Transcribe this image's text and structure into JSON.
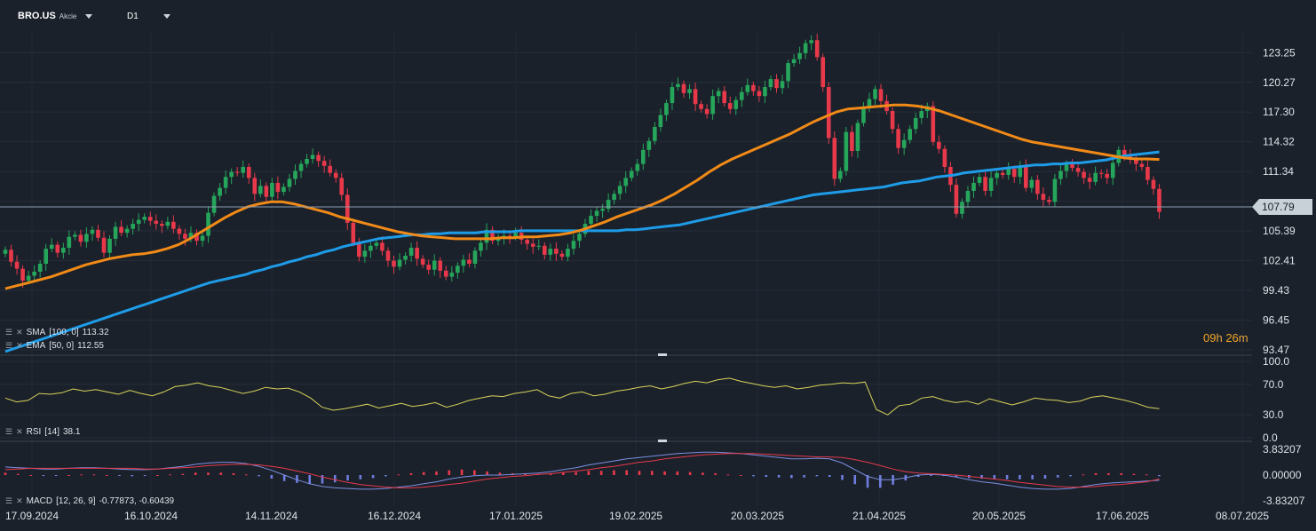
{
  "header": {
    "symbol": "BRO.US",
    "symbol_type": "Akcie",
    "timeframe": "D1"
  },
  "countdown": {
    "hours": "09",
    "h_unit": "h",
    "minutes": "26",
    "m_unit": "m"
  },
  "colors": {
    "background": "#1a212b",
    "up_candle": "#26a65b",
    "down_candle": "#e8394a",
    "sma": "#1e9ce8",
    "ema": "#f18a17",
    "rsi": "#d8d45a",
    "macd_line": "#7d8fe0",
    "signal_line": "#e8394a",
    "hist_pos": "#e8394a",
    "hist_neg": "#6f7de0",
    "price_line": "#8fa0b0",
    "grid": "#252d38"
  },
  "indicators": {
    "sma": {
      "label": "SMA",
      "params": "[100, 0]",
      "value": "113.32"
    },
    "ema": {
      "label": "EMA",
      "params": "[50, 0]",
      "value": "112.55"
    },
    "rsi": {
      "label": "RSI",
      "params": "[14]",
      "value": "38.1"
    },
    "macd": {
      "label": "MACD",
      "params": "[12, 26, 9]",
      "values": "-0.77873, -0.60439"
    }
  },
  "chart_data": [
    {
      "type": "candlestick",
      "title": "BRO.US D1",
      "current_price": 107.79,
      "current_price_label": "107.79",
      "ylim": [
        93.47,
        125.5
      ],
      "y_ticks": [
        "123.25",
        "120.27",
        "117.30",
        "114.32",
        "111.34",
        "108.36",
        "105.39",
        "102.41",
        "99.43",
        "96.45",
        "93.47"
      ],
      "x_ticks": [
        "17.09.2024",
        "16.10.2024",
        "14.11.2024",
        "16.12.2024",
        "17.01.2025",
        "19.02.2025",
        "20.03.2025",
        "21.04.2025",
        "20.05.2025",
        "17.06.2025",
        "08.07.2025"
      ],
      "close": [
        103.5,
        102.3,
        101.6,
        100.4,
        100.9,
        101.3,
        102.1,
        103.6,
        104.0,
        103.2,
        103.7,
        104.8,
        105.0,
        104.3,
        105.1,
        105.5,
        104.7,
        103.2,
        104.6,
        105.8,
        105.2,
        105.6,
        106.1,
        106.5,
        106.8,
        106.4,
        106.1,
        105.9,
        106.3,
        105.6,
        105.1,
        104.6,
        105.2,
        104.4,
        104.9,
        107.2,
        108.9,
        109.7,
        110.8,
        111.3,
        111.2,
        111.8,
        110.7,
        109.1,
        109.9,
        108.8,
        110.2,
        109.3,
        109.8,
        110.6,
        111.4,
        112.1,
        112.6,
        113.0,
        112.4,
        111.9,
        111.2,
        110.7,
        109.0,
        106.2,
        104.2,
        102.8,
        103.4,
        103.9,
        104.2,
        103.4,
        102.4,
        101.8,
        102.5,
        102.9,
        103.7,
        102.6,
        102.0,
        101.5,
        102.4,
        101.4,
        100.8,
        101.2,
        101.9,
        102.5,
        102.1,
        103.4,
        104.2,
        105.5,
        104.4,
        104.6,
        104.9,
        104.8,
        105.2,
        104.5,
        104.1,
        103.8,
        103.9,
        103.0,
        103.6,
        103.1,
        102.8,
        103.6,
        104.4,
        105.1,
        106.1,
        106.9,
        107.4,
        107.6,
        108.5,
        109.1,
        109.9,
        110.7,
        111.4,
        112.1,
        113.5,
        114.4,
        115.8,
        117.0,
        118.2,
        119.8,
        120.1,
        119.2,
        119.6,
        118.1,
        117.6,
        117.1,
        118.9,
        119.4,
        118.2,
        117.6,
        118.5,
        119.3,
        120.0,
        119.4,
        118.9,
        119.8,
        120.6,
        119.7,
        120.4,
        122.2,
        122.6,
        123.2,
        124.2,
        124.5,
        122.8,
        119.8,
        114.7,
        110.6,
        111.4,
        115.3,
        113.4,
        116.2,
        117.8,
        118.6,
        119.6,
        118.4,
        117.4,
        115.6,
        113.7,
        114.5,
        115.6,
        116.7,
        117.4,
        117.9,
        114.3,
        113.6,
        111.8,
        110.0,
        107.1,
        108.3,
        109.4,
        110.2,
        110.8,
        109.4,
        110.7,
        111.2,
        111.0,
        111.6,
        110.8,
        111.9,
        109.7,
        110.5,
        109.1,
        108.5,
        108.3,
        110.6,
        111.4,
        112.1,
        111.7,
        111.3,
        110.7,
        110.3,
        111.2,
        111.1,
        110.7,
        112.2,
        113.5,
        112.9,
        112.7,
        112.1,
        111.8,
        110.5,
        109.6,
        107.3
      ],
      "series": [
        {
          "name": "SMA",
          "params": "[100, 0]",
          "last": 113.32,
          "values": [
            93.3,
            93.6,
            93.9,
            94.2,
            94.5,
            94.8,
            95.1,
            95.4,
            95.7,
            96.0,
            96.3,
            96.6,
            96.9,
            97.2,
            97.5,
            97.8,
            98.1,
            98.4,
            98.7,
            99.0,
            99.3,
            99.6,
            99.9,
            100.2,
            100.4,
            100.6,
            100.8,
            101.0,
            101.3,
            101.5,
            101.8,
            102.0,
            102.3,
            102.5,
            102.8,
            103.0,
            103.3,
            103.5,
            103.8,
            104.0,
            104.2,
            104.4,
            104.6,
            104.7,
            104.8,
            104.9,
            105.0,
            105.0,
            105.1,
            105.1,
            105.2,
            105.2,
            105.2,
            105.2,
            105.3,
            105.3,
            105.3,
            105.3,
            105.4,
            105.4,
            105.4,
            105.4,
            105.4,
            105.4,
            105.4,
            105.4,
            105.4,
            105.4,
            105.4,
            105.4,
            105.5,
            105.5,
            105.6,
            105.7,
            105.8,
            105.9,
            106.0,
            106.2,
            106.4,
            106.6,
            106.8,
            107.0,
            107.2,
            107.4,
            107.6,
            107.8,
            108.0,
            108.2,
            108.4,
            108.6,
            108.8,
            109.0,
            109.1,
            109.2,
            109.3,
            109.4,
            109.5,
            109.6,
            109.7,
            109.8,
            110.0,
            110.2,
            110.3,
            110.4,
            110.6,
            110.8,
            110.9,
            111.0,
            111.2,
            111.3,
            111.4,
            111.5,
            111.6,
            111.7,
            111.8,
            111.9,
            112.0,
            112.0,
            112.1,
            112.1,
            112.2,
            112.2,
            112.3,
            112.4,
            112.5,
            112.7,
            112.9,
            113.0,
            113.1,
            113.2,
            113.3
          ]
        },
        {
          "name": "EMA",
          "params": "[50, 0]",
          "last": 112.55,
          "values": [
            99.6,
            99.9,
            100.2,
            100.5,
            100.8,
            101.2,
            101.6,
            102.0,
            102.3,
            102.6,
            102.8,
            103.0,
            103.1,
            103.3,
            103.6,
            104.0,
            104.6,
            105.3,
            106.0,
            106.7,
            107.3,
            107.8,
            108.1,
            108.3,
            108.3,
            108.1,
            107.8,
            107.5,
            107.2,
            106.8,
            106.5,
            106.2,
            105.9,
            105.6,
            105.3,
            105.1,
            104.9,
            104.8,
            104.7,
            104.6,
            104.6,
            104.6,
            104.6,
            104.7,
            104.7,
            104.8,
            104.8,
            104.9,
            105.0,
            105.2,
            105.5,
            105.9,
            106.3,
            106.8,
            107.2,
            107.6,
            108.0,
            108.5,
            109.1,
            109.8,
            110.5,
            111.3,
            112.0,
            112.6,
            113.1,
            113.6,
            114.1,
            114.6,
            115.1,
            115.7,
            116.3,
            116.8,
            117.3,
            117.6,
            117.7,
            117.8,
            117.9,
            118.0,
            118.0,
            117.9,
            117.7,
            117.4,
            117.0,
            116.6,
            116.2,
            115.8,
            115.4,
            115.0,
            114.6,
            114.3,
            114.1,
            113.9,
            113.7,
            113.5,
            113.3,
            113.1,
            112.9,
            112.7,
            112.6,
            112.6,
            112.55
          ]
        },
        {
          "name": "RSI",
          "params": "[14]",
          "last": 38.1,
          "values": [
            52,
            47,
            49,
            58,
            57,
            59,
            64,
            61,
            63,
            60,
            57,
            62,
            58,
            55,
            60,
            67,
            69,
            72,
            68,
            66,
            62,
            58,
            61,
            66,
            64,
            65,
            60,
            52,
            40,
            36,
            38,
            41,
            44,
            39,
            42,
            45,
            41,
            43,
            46,
            40,
            44,
            49,
            52,
            55,
            54,
            58,
            60,
            63,
            55,
            52,
            58,
            60,
            55,
            57,
            61,
            63,
            66,
            68,
            64,
            67,
            71,
            74,
            72,
            76,
            78,
            74,
            71,
            68,
            66,
            68,
            64,
            66,
            69,
            70,
            72,
            71,
            73,
            37,
            30,
            42,
            44,
            52,
            54,
            49,
            46,
            48,
            44,
            51,
            47,
            43,
            47,
            52,
            50,
            49,
            46,
            48,
            53,
            55,
            52,
            49,
            45,
            40,
            38
          ]
        },
        {
          "name": "MACD",
          "params": "[12, 26, 9]",
          "last": -0.77873,
          "values": [
            1.2,
            1.1,
            1.0,
            0.9,
            0.9,
            1.0,
            1.1,
            1.1,
            1.0,
            0.9,
            0.8,
            0.8,
            0.9,
            1.1,
            1.3,
            1.6,
            1.8,
            1.9,
            1.9,
            1.7,
            1.3,
            0.7,
            0.0,
            -0.7,
            -1.3,
            -1.7,
            -1.9,
            -2.0,
            -2.1,
            -2.1,
            -2.0,
            -1.8,
            -1.6,
            -1.3,
            -1.0,
            -0.6,
            -0.3,
            -0.1,
            0.0,
            0.0,
            0.1,
            0.2,
            0.3,
            0.5,
            0.8,
            1.1,
            1.5,
            1.8,
            2.1,
            2.4,
            2.6,
            2.8,
            3.0,
            3.2,
            3.3,
            3.4,
            3.4,
            3.3,
            3.2,
            3.0,
            2.8,
            2.6,
            2.4,
            2.4,
            2.5,
            2.4,
            1.8,
            0.8,
            -0.2,
            -0.7,
            -0.7,
            -0.4,
            0.0,
            0.1,
            0.0,
            -0.3,
            -0.7,
            -1.0,
            -1.2,
            -1.5,
            -1.8,
            -2.0,
            -2.1,
            -2.1,
            -2.0,
            -1.7,
            -1.4,
            -1.2,
            -1.1,
            -1.0,
            -0.9,
            -0.78
          ]
        },
        {
          "name": "Signal",
          "values": [
            0.8,
            0.9,
            1.0,
            1.0,
            1.0,
            1.0,
            1.0,
            1.0,
            1.0,
            1.0,
            1.0,
            0.9,
            0.9,
            1.0,
            1.1,
            1.2,
            1.4,
            1.5,
            1.6,
            1.6,
            1.5,
            1.3,
            1.0,
            0.6,
            0.2,
            -0.3,
            -0.7,
            -1.1,
            -1.4,
            -1.6,
            -1.8,
            -1.9,
            -1.9,
            -1.8,
            -1.6,
            -1.4,
            -1.2,
            -0.9,
            -0.6,
            -0.4,
            -0.2,
            -0.1,
            0.1,
            0.2,
            0.4,
            0.6,
            0.8,
            1.1,
            1.3,
            1.6,
            1.9,
            2.1,
            2.4,
            2.6,
            2.8,
            3.0,
            3.1,
            3.2,
            3.2,
            3.2,
            3.1,
            3.0,
            2.9,
            2.8,
            2.7,
            2.7,
            2.6,
            2.3,
            1.9,
            1.4,
            0.9,
            0.5,
            0.3,
            0.2,
            0.1,
            0.0,
            -0.2,
            -0.4,
            -0.6,
            -0.8,
            -1.1,
            -1.3,
            -1.5,
            -1.7,
            -1.8,
            -1.8,
            -1.7,
            -1.5,
            -1.4,
            -1.2,
            -1.0,
            -0.6
          ]
        }
      ],
      "panels": [
        {
          "name": "RSI",
          "ylim": [
            0,
            100
          ],
          "y_ticks": [
            "100.0",
            "70.0",
            "30.0",
            "0.0"
          ]
        },
        {
          "name": "MACD",
          "ylim": [
            -3.83207,
            3.83207
          ],
          "y_ticks": [
            "3.83207",
            "0.00000",
            "-3.83207"
          ]
        }
      ]
    }
  ]
}
